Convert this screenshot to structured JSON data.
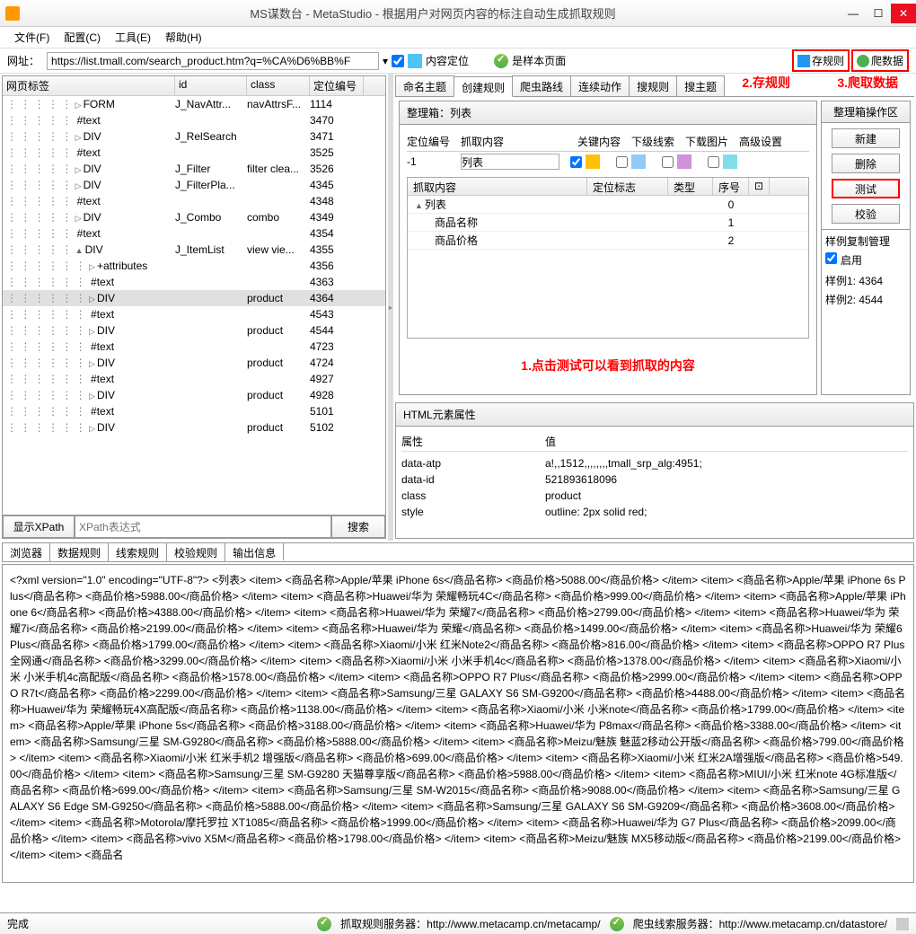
{
  "title": "MS谋数台 - MetaStudio - 根据用户对网页内容的标注自动生成抓取规则",
  "menubar": [
    "文件(F)",
    "配置(C)",
    "工具(E)",
    "帮助(H)"
  ],
  "toolbar": {
    "url_label": "网址：",
    "url": "https://list.tmall.com/search_product.htm?q=%CA%D6%BB%F",
    "loc_label": "内容定位",
    "sample_label": "是样本页面",
    "save_label": "存规则",
    "crawl_label": "爬数据"
  },
  "annotations": {
    "a1": "1.点击测试可以看到抓取的内容",
    "a2": "2.存规则",
    "a3": "3.爬取数据"
  },
  "tree": {
    "headers": [
      "网页标签",
      "id",
      "class",
      "定位编号"
    ],
    "rows": [
      {
        "ind": 5,
        "tri": "▷",
        "tag": "FORM",
        "id": "J_NavAttr...",
        "cls": "navAttrsF...",
        "num": "1114"
      },
      {
        "ind": 5,
        "tri": "",
        "tag": "#text",
        "id": "",
        "cls": "",
        "num": "3470"
      },
      {
        "ind": 5,
        "tri": "▷",
        "tag": "DIV",
        "id": "J_RelSearch",
        "cls": "",
        "num": "3471"
      },
      {
        "ind": 5,
        "tri": "",
        "tag": "#text",
        "id": "",
        "cls": "",
        "num": "3525"
      },
      {
        "ind": 5,
        "tri": "▷",
        "tag": "DIV",
        "id": "J_Filter",
        "cls": "filter clea...",
        "num": "3526"
      },
      {
        "ind": 5,
        "tri": "▷",
        "tag": "DIV",
        "id": "J_FilterPla...",
        "cls": "",
        "num": "4345"
      },
      {
        "ind": 5,
        "tri": "",
        "tag": "#text",
        "id": "",
        "cls": "",
        "num": "4348"
      },
      {
        "ind": 5,
        "tri": "▷",
        "tag": "DIV",
        "id": "J_Combo",
        "cls": "combo",
        "num": "4349"
      },
      {
        "ind": 5,
        "tri": "",
        "tag": "#text",
        "id": "",
        "cls": "",
        "num": "4354"
      },
      {
        "ind": 5,
        "tri": "▲",
        "tag": "DIV",
        "id": "J_ItemList",
        "cls": "view  vie...",
        "num": "4355"
      },
      {
        "ind": 6,
        "tri": "▷",
        "tag": "+attributes",
        "id": "",
        "cls": "",
        "num": "4356"
      },
      {
        "ind": 6,
        "tri": "",
        "tag": "#text",
        "id": "",
        "cls": "",
        "num": "4363"
      },
      {
        "ind": 6,
        "tri": "▷",
        "tag": "DIV",
        "id": "",
        "cls": "product",
        "num": "4364",
        "sel": true
      },
      {
        "ind": 6,
        "tri": "",
        "tag": "#text",
        "id": "",
        "cls": "",
        "num": "4543"
      },
      {
        "ind": 6,
        "tri": "▷",
        "tag": "DIV",
        "id": "",
        "cls": "product",
        "num": "4544"
      },
      {
        "ind": 6,
        "tri": "",
        "tag": "#text",
        "id": "",
        "cls": "",
        "num": "4723"
      },
      {
        "ind": 6,
        "tri": "▷",
        "tag": "DIV",
        "id": "",
        "cls": "product",
        "num": "4724"
      },
      {
        "ind": 6,
        "tri": "",
        "tag": "#text",
        "id": "",
        "cls": "",
        "num": "4927"
      },
      {
        "ind": 6,
        "tri": "▷",
        "tag": "DIV",
        "id": "",
        "cls": "product",
        "num": "4928"
      },
      {
        "ind": 6,
        "tri": "",
        "tag": "#text",
        "id": "",
        "cls": "",
        "num": "5101"
      },
      {
        "ind": 6,
        "tri": "▷",
        "tag": "DIV",
        "id": "",
        "cls": "product",
        "num": "5102"
      }
    ]
  },
  "xpath": {
    "btn": "显示XPath",
    "ph": "XPath表达式",
    "search": "搜索"
  },
  "rtabs": [
    "命名主题",
    "创建规则",
    "爬虫路线",
    "连续动作",
    "搜规则",
    "搜主题"
  ],
  "rtabs_active": 1,
  "rulebox": {
    "title": "整理箱：列表",
    "cols": [
      "定位编号",
      "抓取内容",
      "关键内容",
      "下级线索",
      "下载图片",
      "高级设置"
    ],
    "loc_num": "-1",
    "content": "列表",
    "tree_cols": [
      "抓取内容",
      "定位标志",
      "类型",
      "序号"
    ],
    "tree_rows": [
      {
        "name": "列表",
        "seq": "0",
        "ind": 0,
        "tri": "▲"
      },
      {
        "name": "商品名称",
        "seq": "1",
        "ind": 1,
        "tri": ""
      },
      {
        "name": "商品价格",
        "seq": "2",
        "ind": 1,
        "tri": ""
      }
    ]
  },
  "ops": {
    "title": "整理箱操作区",
    "new": "新建",
    "del": "删除",
    "test": "测试",
    "verify": "校验",
    "copy_title": "样例复制管理",
    "enable": "启用",
    "s1": "样例1: 4364",
    "s2": "样例2: 4544"
  },
  "attrs": {
    "title": "HTML元素属性",
    "k": "属性",
    "v": "值",
    "rows": [
      {
        "k": "data-atp",
        "v": "a!,,1512,,,,,,,,tmall_srp_alg:4951;"
      },
      {
        "k": "data-id",
        "v": "521893618096"
      },
      {
        "k": "class",
        "v": "product"
      },
      {
        "k": "style",
        "v": "outline: 2px solid red;"
      }
    ]
  },
  "btabs": [
    "浏览器",
    "数据规则",
    "线索规则",
    "校验规则",
    "输出信息"
  ],
  "btabs_active": 4,
  "output": "<?xml version=\"1.0\" encoding=\"UTF-8\"?>\n<列表> <item> <商品名称>Apple/苹果 iPhone 6s</商品名称> <商品价格>5088.00</商品价格> </item> <item> <商品名称>Apple/苹果 iPhone 6s Plus</商品名称> <商品价格>5988.00</商品价格> </item> <item> <商品名称>Huawei/华为 荣耀畅玩4C</商品名称> <商品价格>999.00</商品价格> </item> <item> <商品名称>Apple/苹果 iPhone 6</商品名称> <商品价格>4388.00</商品价格> </item> <item> <商品名称>Huawei/华为 荣耀7</商品名称> <商品价格>2799.00</商品价格> </item> <item> <商品名称>Huawei/华为 荣耀7i</商品名称> <商品价格>2199.00</商品价格> </item> <item> <商品名称>Huawei/华为 荣耀</商品名称> <商品价格>1499.00</商品价格> </item> <item> <商品名称>Huawei/华为 荣耀6 Plus</商品名称> <商品价格>1799.00</商品价格> </item> <item> <商品名称>Xiaomi/小米 红米Note2</商品名称> <商品价格>816.00</商品价格> </item> <item> <商品名称>OPPO R7 Plus 全网通</商品名称> <商品价格>3299.00</商品价格> </item> <item> <商品名称>Xiaomi/小米 小米手机4c</商品名称> <商品价格>1378.00</商品价格> </item> <item> <商品名称>Xiaomi/小米 小米手机4c高配版</商品名称> <商品价格>1578.00</商品价格> </item> <item> <商品名称>OPPO R7 Plus</商品名称> <商品价格>2999.00</商品价格> </item> <item> <商品名称>OPPO R7t</商品名称> <商品价格>2299.00</商品价格> </item> <item> <商品名称>Samsung/三星 GALAXY S6 SM-G9200</商品名称> <商品价格>4488.00</商品价格> </item> <item> <商品名称>Huawei/华为 荣耀畅玩4X高配版</商品名称> <商品价格>1138.00</商品价格> </item> <item> <商品名称>Xiaomi/小米 小米note</商品名称> <商品价格>1799.00</商品价格> </item> <item> <商品名称>Apple/苹果 iPhone 5s</商品名称> <商品价格>3188.00</商品价格> </item> <item> <商品名称>Huawei/华为 P8max</商品名称> <商品价格>3388.00</商品价格> </item> <item> <商品名称>Samsung/三星 SM-G9280</商品名称> <商品价格>5888.00</商品价格> </item> <item> <商品名称>Meizu/魅族 魅蓝2移动公开版</商品名称> <商品价格>799.00</商品价格> </item> <item> <商品名称>Xiaomi/小米 红米手机2 增强版</商品名称> <商品价格>699.00</商品价格> </item> <item> <商品名称>Xiaomi/小米 红米2A增强版</商品名称> <商品价格>549.00</商品价格> </item> <item> <商品名称>Samsung/三星 SM-G9280 天猫尊享版</商品名称> <商品价格>5988.00</商品价格> </item> <item> <商品名称>MIUI/小米 红米note 4G标准版</商品名称> <商品价格>699.00</商品价格> </item> <item> <商品名称>Samsung/三星 SM-W2015</商品名称> <商品价格>9088.00</商品价格> </item> <item> <商品名称>Samsung/三星 GALAXY S6 Edge SM-G9250</商品名称> <商品价格>5888.00</商品价格> </item> <item> <商品名称>Samsung/三星 GALAXY S6 SM-G9209</商品名称> <商品价格>3608.00</商品价格> </item> <item> <商品名称>Motorola/摩托罗拉 XT1085</商品名称> <商品价格>1999.00</商品价格> </item> <item> <商品名称>Huawei/华为 G7 Plus</商品名称> <商品价格>2099.00</商品价格> </item> <item> <商品名称>vivo X5M</商品名称> <商品价格>1798.00</商品价格> </item> <item> <商品名称>Meizu/魅族 MX5移动版</商品名称> <商品价格>2199.00</商品价格> </item> <item> <商品名",
  "status": {
    "done": "完成",
    "s1": "抓取规则服务器：http://www.metacamp.cn/metacamp/",
    "s2": "爬虫线索服务器：http://www.metacamp.cn/datastore/"
  }
}
